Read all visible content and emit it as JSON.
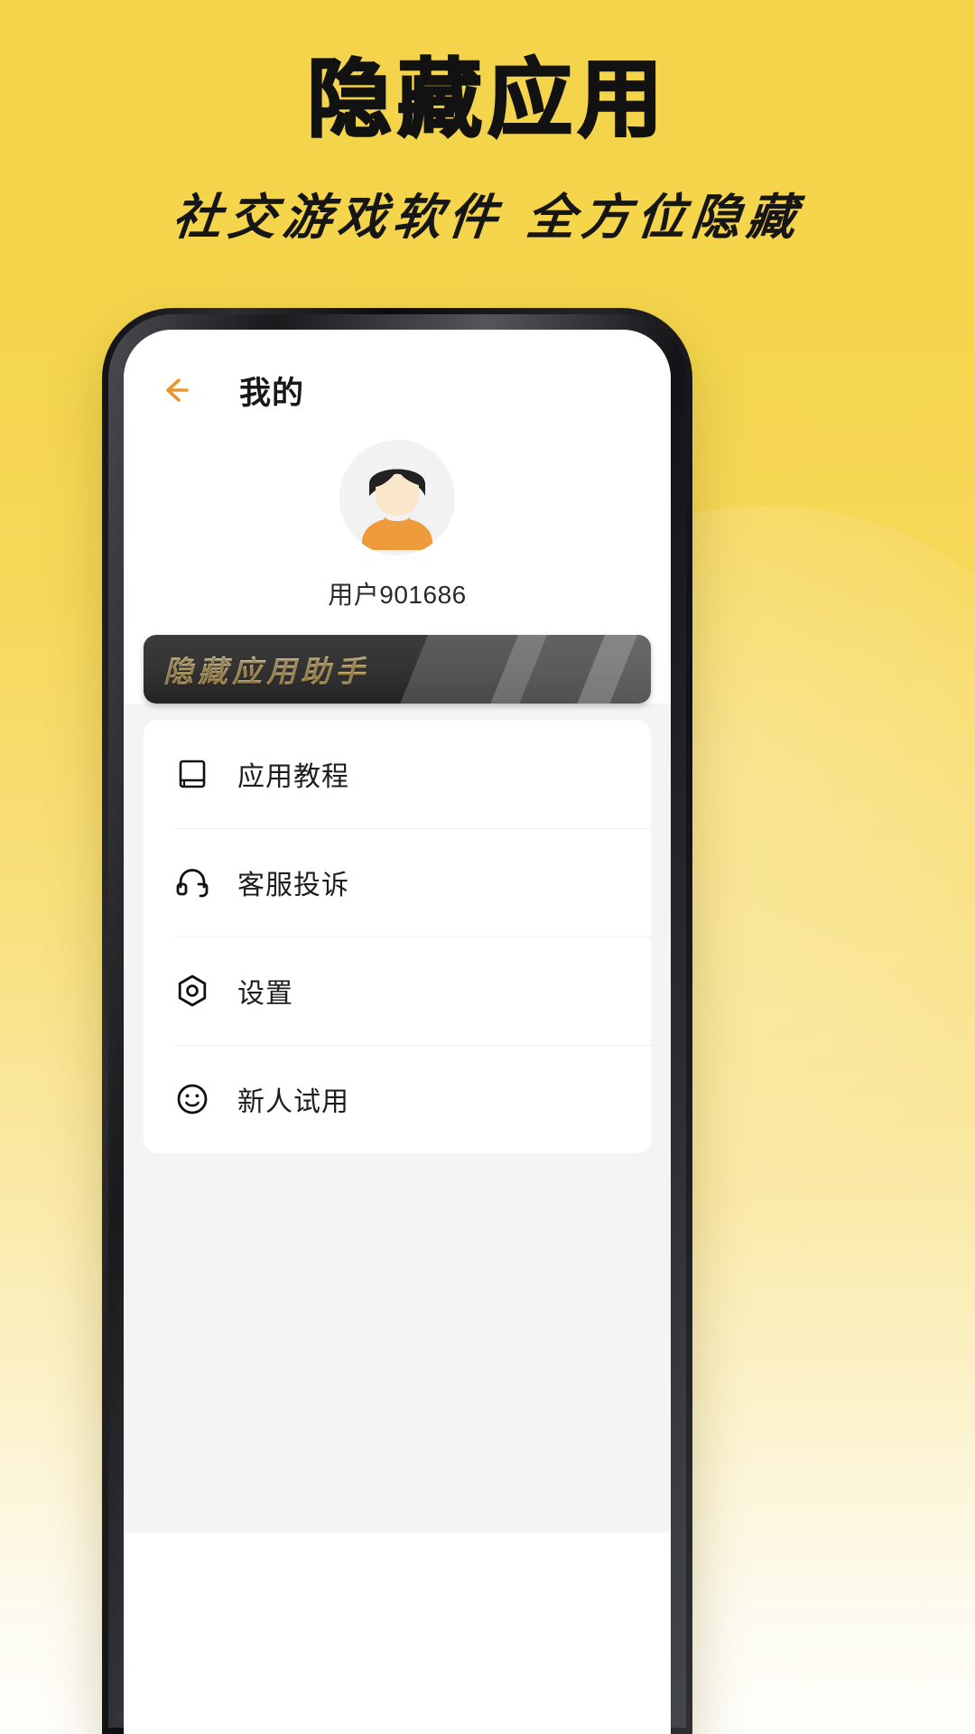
{
  "poster": {
    "headline": "隐藏应用",
    "subheadline": "社交游戏软件 全方位隐藏",
    "background_top_color": "#F4D44A",
    "background_bottom_color": "#FEFEFB",
    "headline_color": "#121212"
  },
  "app": {
    "header": {
      "back_icon": "arrow-left-icon",
      "back_icon_color": "#E8972E",
      "title": "我的"
    },
    "profile": {
      "avatar_icon": "user-avatar-icon",
      "avatar_hair_color": "#1F1F1F",
      "avatar_face_color": "#F9E4C8",
      "avatar_body_color": "#EE9B3C",
      "avatar_bg_color": "#F2F2F2",
      "username": "用户901686"
    },
    "banner": {
      "text": "隐藏应用助手",
      "background_color": "#343434",
      "text_color": "#E7C983"
    },
    "menu": [
      {
        "icon": "book-icon",
        "label": "应用教程"
      },
      {
        "icon": "headset-icon",
        "label": "客服投诉"
      },
      {
        "icon": "gear-icon",
        "label": "设置"
      },
      {
        "icon": "smiley-icon",
        "label": "新人试用"
      }
    ]
  }
}
